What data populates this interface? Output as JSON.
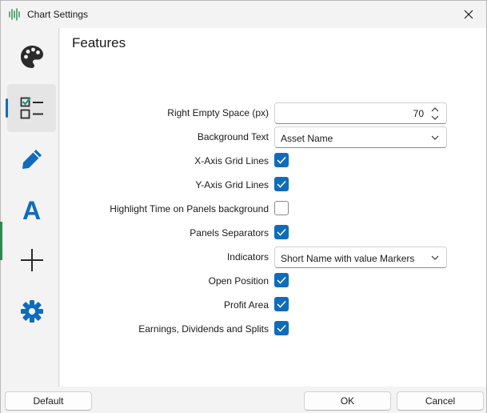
{
  "window": {
    "title": "Chart Settings"
  },
  "sidebar": {
    "items": [
      {
        "icon": "palette-icon"
      },
      {
        "icon": "checklist-icon",
        "active": true
      },
      {
        "icon": "pencil-icon"
      },
      {
        "icon": "font-a-icon",
        "glyph": "A"
      },
      {
        "icon": "crosshair-icon"
      },
      {
        "icon": "gear-icon"
      }
    ]
  },
  "features": {
    "heading": "Features",
    "right_empty_space": {
      "label": "Right Empty Space (px)",
      "value": "70"
    },
    "background_text": {
      "label": "Background Text",
      "value": "Asset Name"
    },
    "x_axis_grid": {
      "label": "X-Axis Grid Lines",
      "checked": true
    },
    "y_axis_grid": {
      "label": "Y-Axis Grid Lines",
      "checked": true
    },
    "highlight_time": {
      "label": "Highlight Time on Panels background",
      "checked": false
    },
    "panels_separators": {
      "label": "Panels Separators",
      "checked": true
    },
    "indicators": {
      "label": "Indicators",
      "value": "Short Name with value Markers"
    },
    "open_position": {
      "label": "Open Position",
      "checked": true
    },
    "profit_area": {
      "label": "Profit Area",
      "checked": true
    },
    "earnings": {
      "label": "Earnings, Dividends and Splits",
      "checked": true
    }
  },
  "footer": {
    "default_label": "Default",
    "ok_label": "OK",
    "cancel_label": "Cancel"
  },
  "colors": {
    "accent": "#0f6cbd",
    "brand_green": "#2a8b4f",
    "icon_dark": "#2b2b2b"
  }
}
